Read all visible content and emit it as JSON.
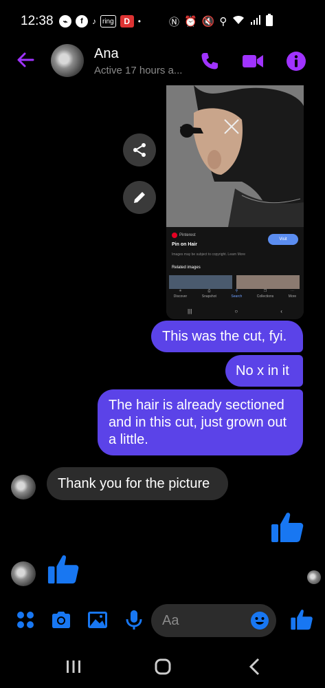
{
  "status_bar": {
    "time": "12:38",
    "left_icons": [
      "messenger-icon",
      "facebook-icon",
      "tiktok-icon",
      "ring-icon",
      "app-icon",
      "dot-icon"
    ],
    "ring_label": "ring",
    "right_icons": [
      "nfc-icon",
      "alarm-icon",
      "mute-icon",
      "location-icon",
      "wifi-icon",
      "signal-icon",
      "battery-icon"
    ]
  },
  "header": {
    "name": "Ana",
    "status": "Active 17 hours a...",
    "accent": "#a033ff"
  },
  "image_message": {
    "source": "Pinterest",
    "title": "Pin on Hair",
    "visit_label": "Visit",
    "copyright": "Images may be subject to copyright. Learn More",
    "related": "Related images",
    "nav": [
      "Discover",
      "Snapshot",
      "Search",
      "Collections",
      "More"
    ],
    "nav_active": "Search"
  },
  "messages": [
    {
      "direction": "out",
      "text": "This was the cut, fyi."
    },
    {
      "direction": "out",
      "text": "No x in it"
    },
    {
      "direction": "out",
      "text": "The hair is already sectioned and in this cut, just grown out a little."
    },
    {
      "direction": "in",
      "text": "Thank you for the picture"
    }
  ],
  "composer": {
    "placeholder": "Aa",
    "icons": [
      "apps-icon",
      "camera-icon",
      "gallery-icon",
      "mic-icon",
      "emoji-icon",
      "like-icon"
    ]
  },
  "colors": {
    "outgoing_bubble": "#5b43e8",
    "incoming_bubble": "#2c2c2c",
    "composer_blue": "#1877f2",
    "like_blue": "#1877f2"
  }
}
